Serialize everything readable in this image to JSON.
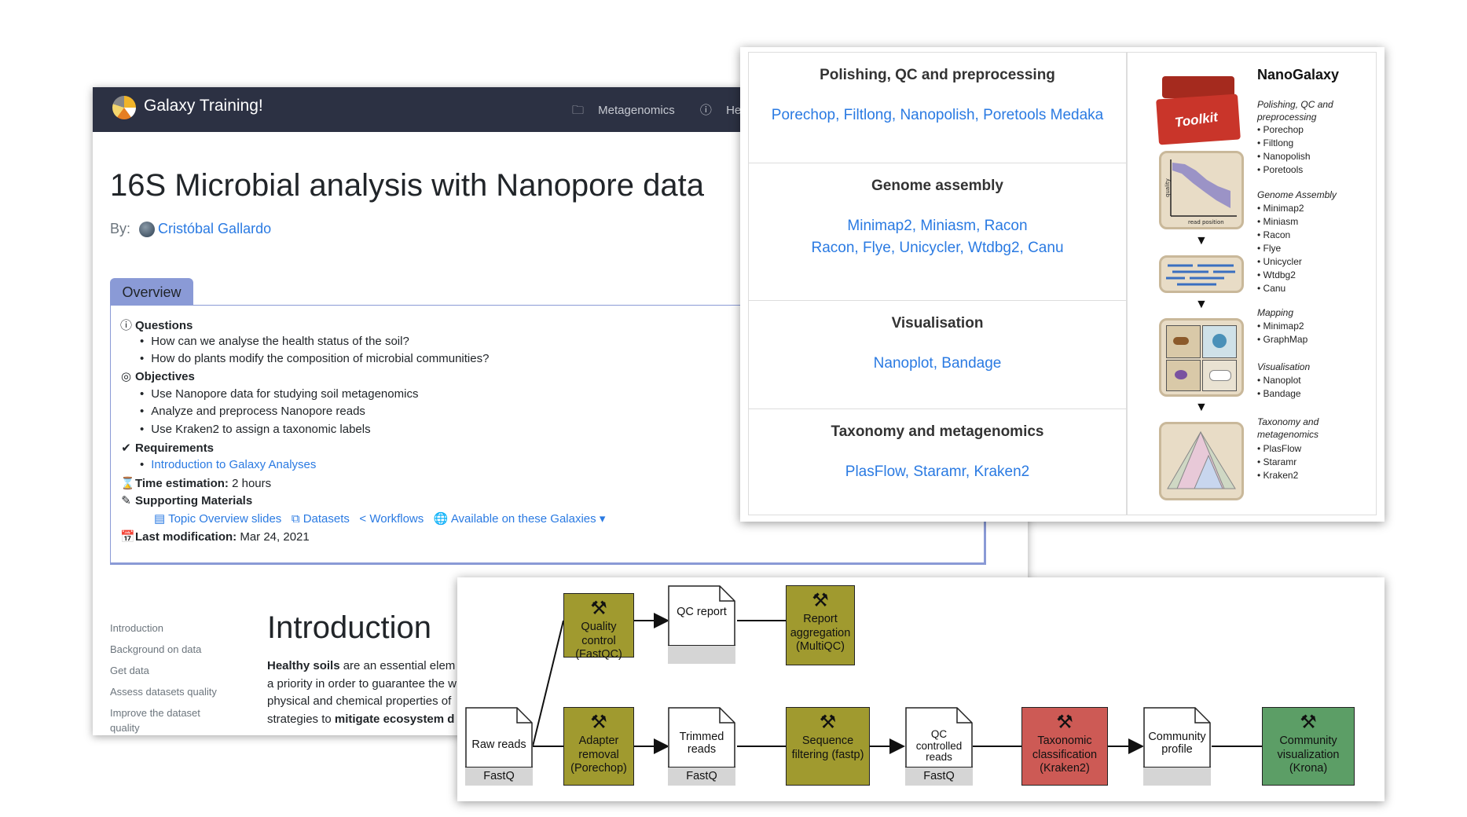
{
  "navbar": {
    "brand": "Galaxy Training!",
    "metagenomics": "Metagenomics",
    "help": "Help"
  },
  "page": {
    "title": "16S Microbial analysis with Nanopore data",
    "by_label": "By:",
    "author": "Cristóbal Gallardo",
    "tab": "Overview"
  },
  "overview": {
    "questions_label": "Questions",
    "questions": [
      "How can we analyse the health status of the soil?",
      "How do plants modify the composition of microbial communities?"
    ],
    "objectives_label": "Objectives",
    "objectives": [
      "Use Nanopore data for studying soil metagenomics",
      "Analyze and preprocess Nanopore reads",
      "Use Kraken2 to assign a taxonomic labels"
    ],
    "requirements_label": "Requirements",
    "requirements": [
      "Introduction to Galaxy Analyses"
    ],
    "time_label": "Time estimation:",
    "time_value": "2 hours",
    "supporting_label": "Supporting Materials",
    "supporting": [
      "Topic Overview slides",
      "Datasets",
      "Workflows",
      "Available on these Galaxies"
    ],
    "lastmod_label": "Last modification:",
    "lastmod_value": "Mar 24, 2021"
  },
  "sidebar": [
    "Introduction",
    "Background on data",
    "Get data",
    "Assess datasets quality",
    "Improve the dataset quality"
  ],
  "intro": {
    "heading": "Introduction",
    "p1_bold": "Healthy soils",
    "p1_rest": " are an essential elem",
    "p2": "a priority in order to guarantee the w",
    "p3": "physical and chemical properties of",
    "p4_pre": "strategies to ",
    "p4_bold": "mitigate ecosystem d"
  },
  "nano_table": {
    "sections": [
      {
        "heading": "Polishing, QC and preprocessing",
        "lines": [
          "Porechop, Filtlong, Nanopolish, Poretools Medaka"
        ]
      },
      {
        "heading": "Genome assembly",
        "lines": [
          "Minimap2, Miniasm, Racon",
          "Racon, Flye, Unicycler, Wtdbg2, Canu"
        ]
      },
      {
        "heading": "Visualisation",
        "lines": [
          "Nanoplot, Bandage"
        ]
      },
      {
        "heading": "Taxonomy and metagenomics",
        "lines": [
          "PlasFlow, Staramr, Kraken2"
        ]
      }
    ]
  },
  "nano_side": {
    "title": "NanoGalaxy",
    "toolkit_label": "Toolkit",
    "quality_label": "quality",
    "read_position_label": "read position",
    "groups": [
      {
        "heading": "Polishing, QC and preprocessing",
        "items": [
          "Porechop",
          "Filtlong",
          "Nanopolish",
          "Poretools"
        ]
      },
      {
        "heading": "Genome Assembly",
        "items": [
          "Minimap2",
          "Miniasm",
          "Racon",
          "Flye",
          "Unicycler",
          "Wtdbg2",
          "Canu"
        ]
      },
      {
        "heading": "Mapping",
        "items": [
          "Minimap2",
          "GraphMap"
        ]
      },
      {
        "heading": "Visualisation",
        "items": [
          "Nanoplot",
          "Bandage"
        ]
      },
      {
        "heading": "Taxonomy and metagenomics",
        "items": [
          "PlasFlow",
          "Staramr",
          "Kraken2"
        ]
      }
    ]
  },
  "workflow": {
    "tools": [
      {
        "id": "qc",
        "label": "Quality control (FastQC)",
        "color": "#a09a2f"
      },
      {
        "id": "report",
        "label": "Report aggregation (MultiQC)",
        "color": "#a09a2f"
      },
      {
        "id": "adapter",
        "label": "Adapter removal (Porechop)",
        "color": "#a09a2f"
      },
      {
        "id": "filter",
        "label": "Sequence filtering (fastp)",
        "color": "#a09a2f"
      },
      {
        "id": "kraken",
        "label": "Taxonomic classification (Kraken2)",
        "color": "#cd5a55"
      },
      {
        "id": "krona",
        "label": "Community visualization (Krona)",
        "color": "#5c9e66"
      }
    ],
    "datasets": [
      {
        "id": "raw",
        "label": "Raw reads",
        "format": "FastQ"
      },
      {
        "id": "qcreport",
        "label": "QC report",
        "format": ""
      },
      {
        "id": "trimmed",
        "label": "Trimmed reads",
        "format": "FastQ"
      },
      {
        "id": "qcc",
        "label": "QC controlled reads",
        "format": "FastQ"
      },
      {
        "id": "profile",
        "label": "Community profile",
        "format": ""
      }
    ]
  }
}
